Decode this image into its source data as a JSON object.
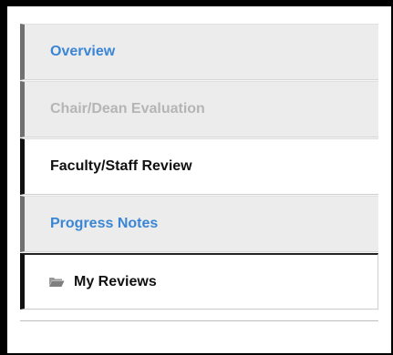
{
  "nav": {
    "items": [
      {
        "label": "Overview"
      },
      {
        "label": "Chair/Dean Evaluation"
      },
      {
        "label": "Faculty/Staff Review"
      },
      {
        "label": "Progress Notes"
      },
      {
        "label": "My Reviews",
        "icon": "folder-open-icon"
      }
    ]
  },
  "colors": {
    "link": "#3a86d4",
    "disabled": "#b5b5b5",
    "active_text": "#111111",
    "item_background": "#ececec",
    "active_background": "#ffffff",
    "border_accent": "#707070"
  }
}
